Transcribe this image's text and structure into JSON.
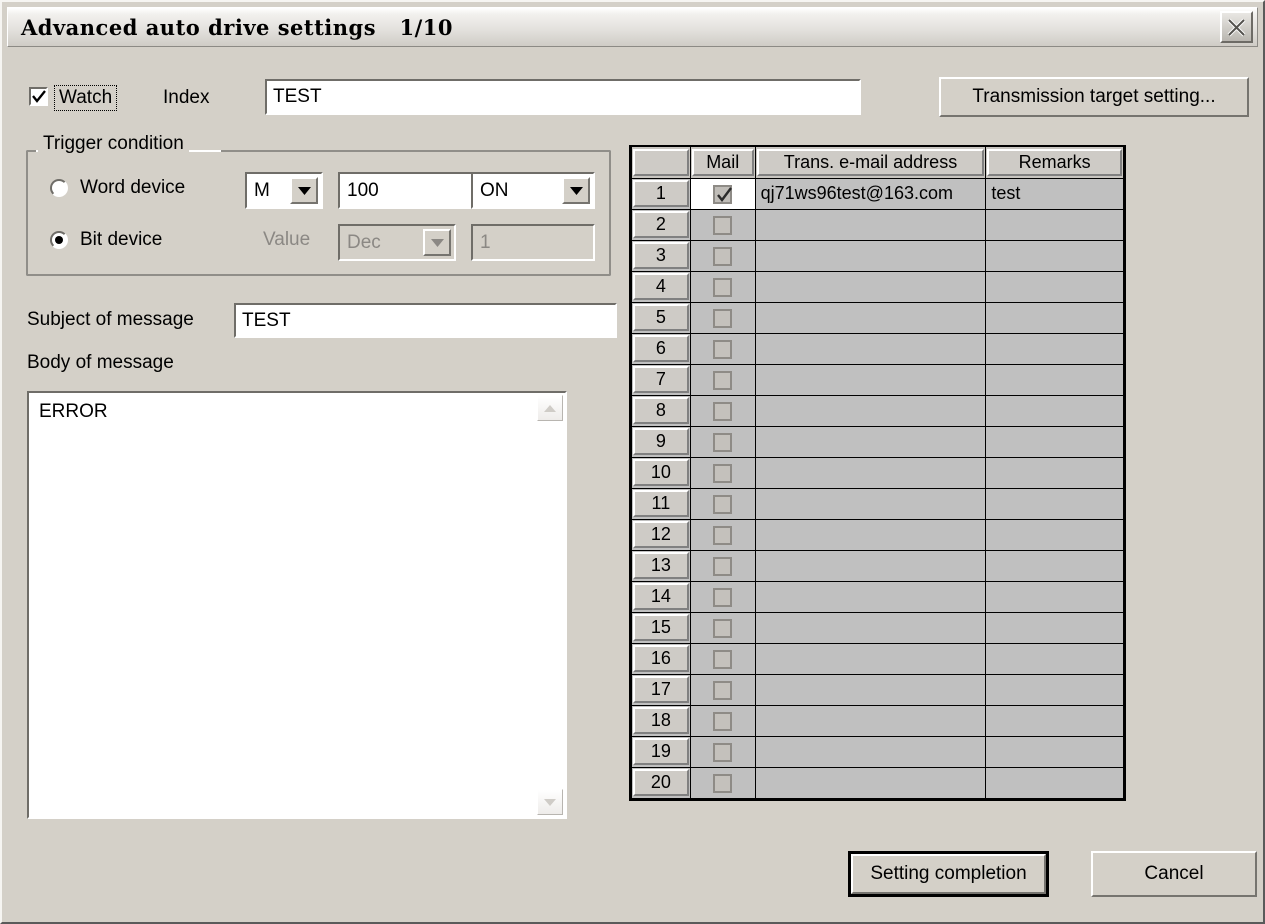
{
  "window": {
    "title": "Advanced auto drive settings   1/10",
    "close_icon": "close-x-icon"
  },
  "header": {
    "watch_label": "Watch",
    "watch_checked": true,
    "index_label": "Index",
    "index_value": "TEST",
    "transmission_button": "Transmission target setting..."
  },
  "trigger": {
    "legend": "Trigger condition",
    "word_device_label": "Word device",
    "word_device_selected": false,
    "bit_device_label": "Bit device",
    "bit_device_selected": true,
    "device_type": "M",
    "device_address": "100",
    "device_state": "ON",
    "value_label": "Value",
    "value_format": "Dec",
    "value_number": "1"
  },
  "message": {
    "subject_label": "Subject of message",
    "subject_value": "TEST",
    "body_label": "Body of message",
    "body_value": "ERROR",
    "scroll_up_icon": "chevron-up-icon",
    "scroll_down_icon": "chevron-down-icon"
  },
  "mail_table": {
    "headers": [
      "",
      "Mail",
      "Trans. e-mail address",
      "Remarks"
    ],
    "rows": [
      {
        "num": "1",
        "mail_checked": true,
        "address": "qj71ws96test@163.com",
        "remarks": "test"
      },
      {
        "num": "2",
        "mail_checked": false,
        "address": "",
        "remarks": ""
      },
      {
        "num": "3",
        "mail_checked": false,
        "address": "",
        "remarks": ""
      },
      {
        "num": "4",
        "mail_checked": false,
        "address": "",
        "remarks": ""
      },
      {
        "num": "5",
        "mail_checked": false,
        "address": "",
        "remarks": ""
      },
      {
        "num": "6",
        "mail_checked": false,
        "address": "",
        "remarks": ""
      },
      {
        "num": "7",
        "mail_checked": false,
        "address": "",
        "remarks": ""
      },
      {
        "num": "8",
        "mail_checked": false,
        "address": "",
        "remarks": ""
      },
      {
        "num": "9",
        "mail_checked": false,
        "address": "",
        "remarks": ""
      },
      {
        "num": "10",
        "mail_checked": false,
        "address": "",
        "remarks": ""
      },
      {
        "num": "11",
        "mail_checked": false,
        "address": "",
        "remarks": ""
      },
      {
        "num": "12",
        "mail_checked": false,
        "address": "",
        "remarks": ""
      },
      {
        "num": "13",
        "mail_checked": false,
        "address": "",
        "remarks": ""
      },
      {
        "num": "14",
        "mail_checked": false,
        "address": "",
        "remarks": ""
      },
      {
        "num": "15",
        "mail_checked": false,
        "address": "",
        "remarks": ""
      },
      {
        "num": "16",
        "mail_checked": false,
        "address": "",
        "remarks": ""
      },
      {
        "num": "17",
        "mail_checked": false,
        "address": "",
        "remarks": ""
      },
      {
        "num": "18",
        "mail_checked": false,
        "address": "",
        "remarks": ""
      },
      {
        "num": "19",
        "mail_checked": false,
        "address": "",
        "remarks": ""
      },
      {
        "num": "20",
        "mail_checked": false,
        "address": "",
        "remarks": ""
      }
    ]
  },
  "footer": {
    "setting_completion": "Setting completion",
    "cancel": "Cancel"
  }
}
